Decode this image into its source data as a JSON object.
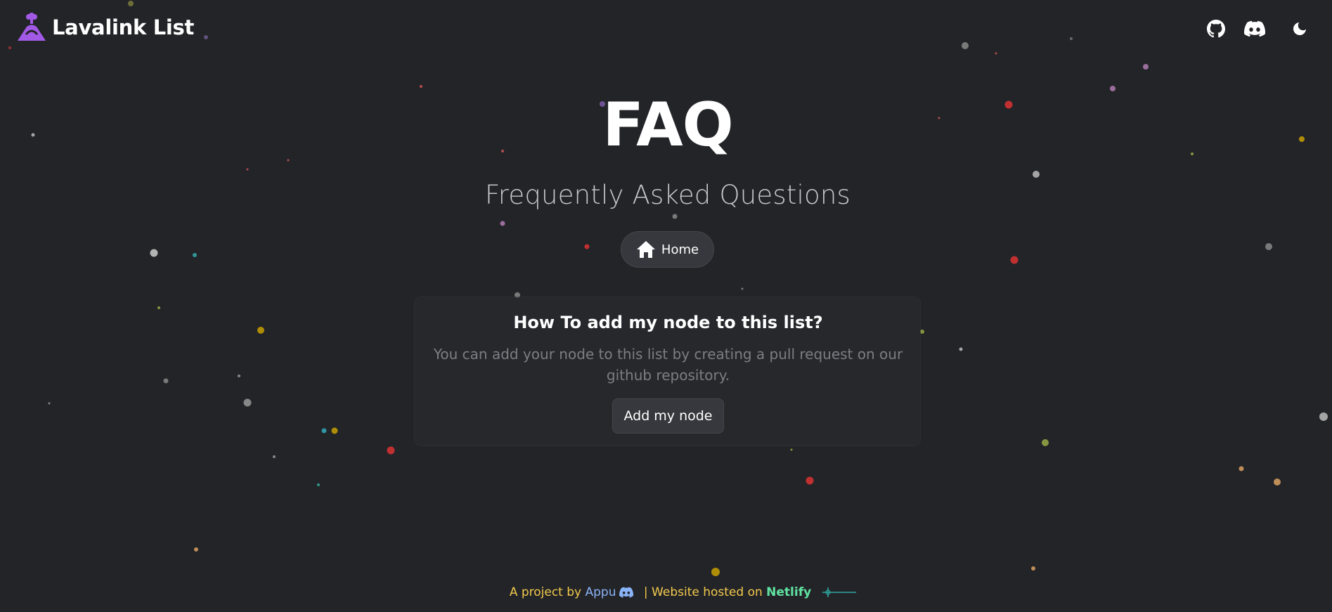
{
  "brand": {
    "name": "Lavalink List",
    "color": "#a25ae6"
  },
  "nav": {
    "icons": [
      "github-icon",
      "discord-icon",
      "moon-icon"
    ]
  },
  "hero": {
    "title": "FAQ",
    "subtitle": "Frequently Asked Questions",
    "home_label": "Home"
  },
  "faq": [
    {
      "question": "How To add my node to this list?",
      "answer": "You can add your node to this list by creating a pull request on our github repository.",
      "button_label": "Add my node"
    }
  ],
  "footer": {
    "prefix": "A project by ",
    "author": "Appu",
    "middle": " | Website hosted on ",
    "host": "Netlify"
  },
  "colors": {
    "background": "#232428",
    "accent": "#a25ae6",
    "footer_text": "#f2c94c",
    "footer_link": "#8ab4f8",
    "netlify": "#5fe3a1"
  }
}
